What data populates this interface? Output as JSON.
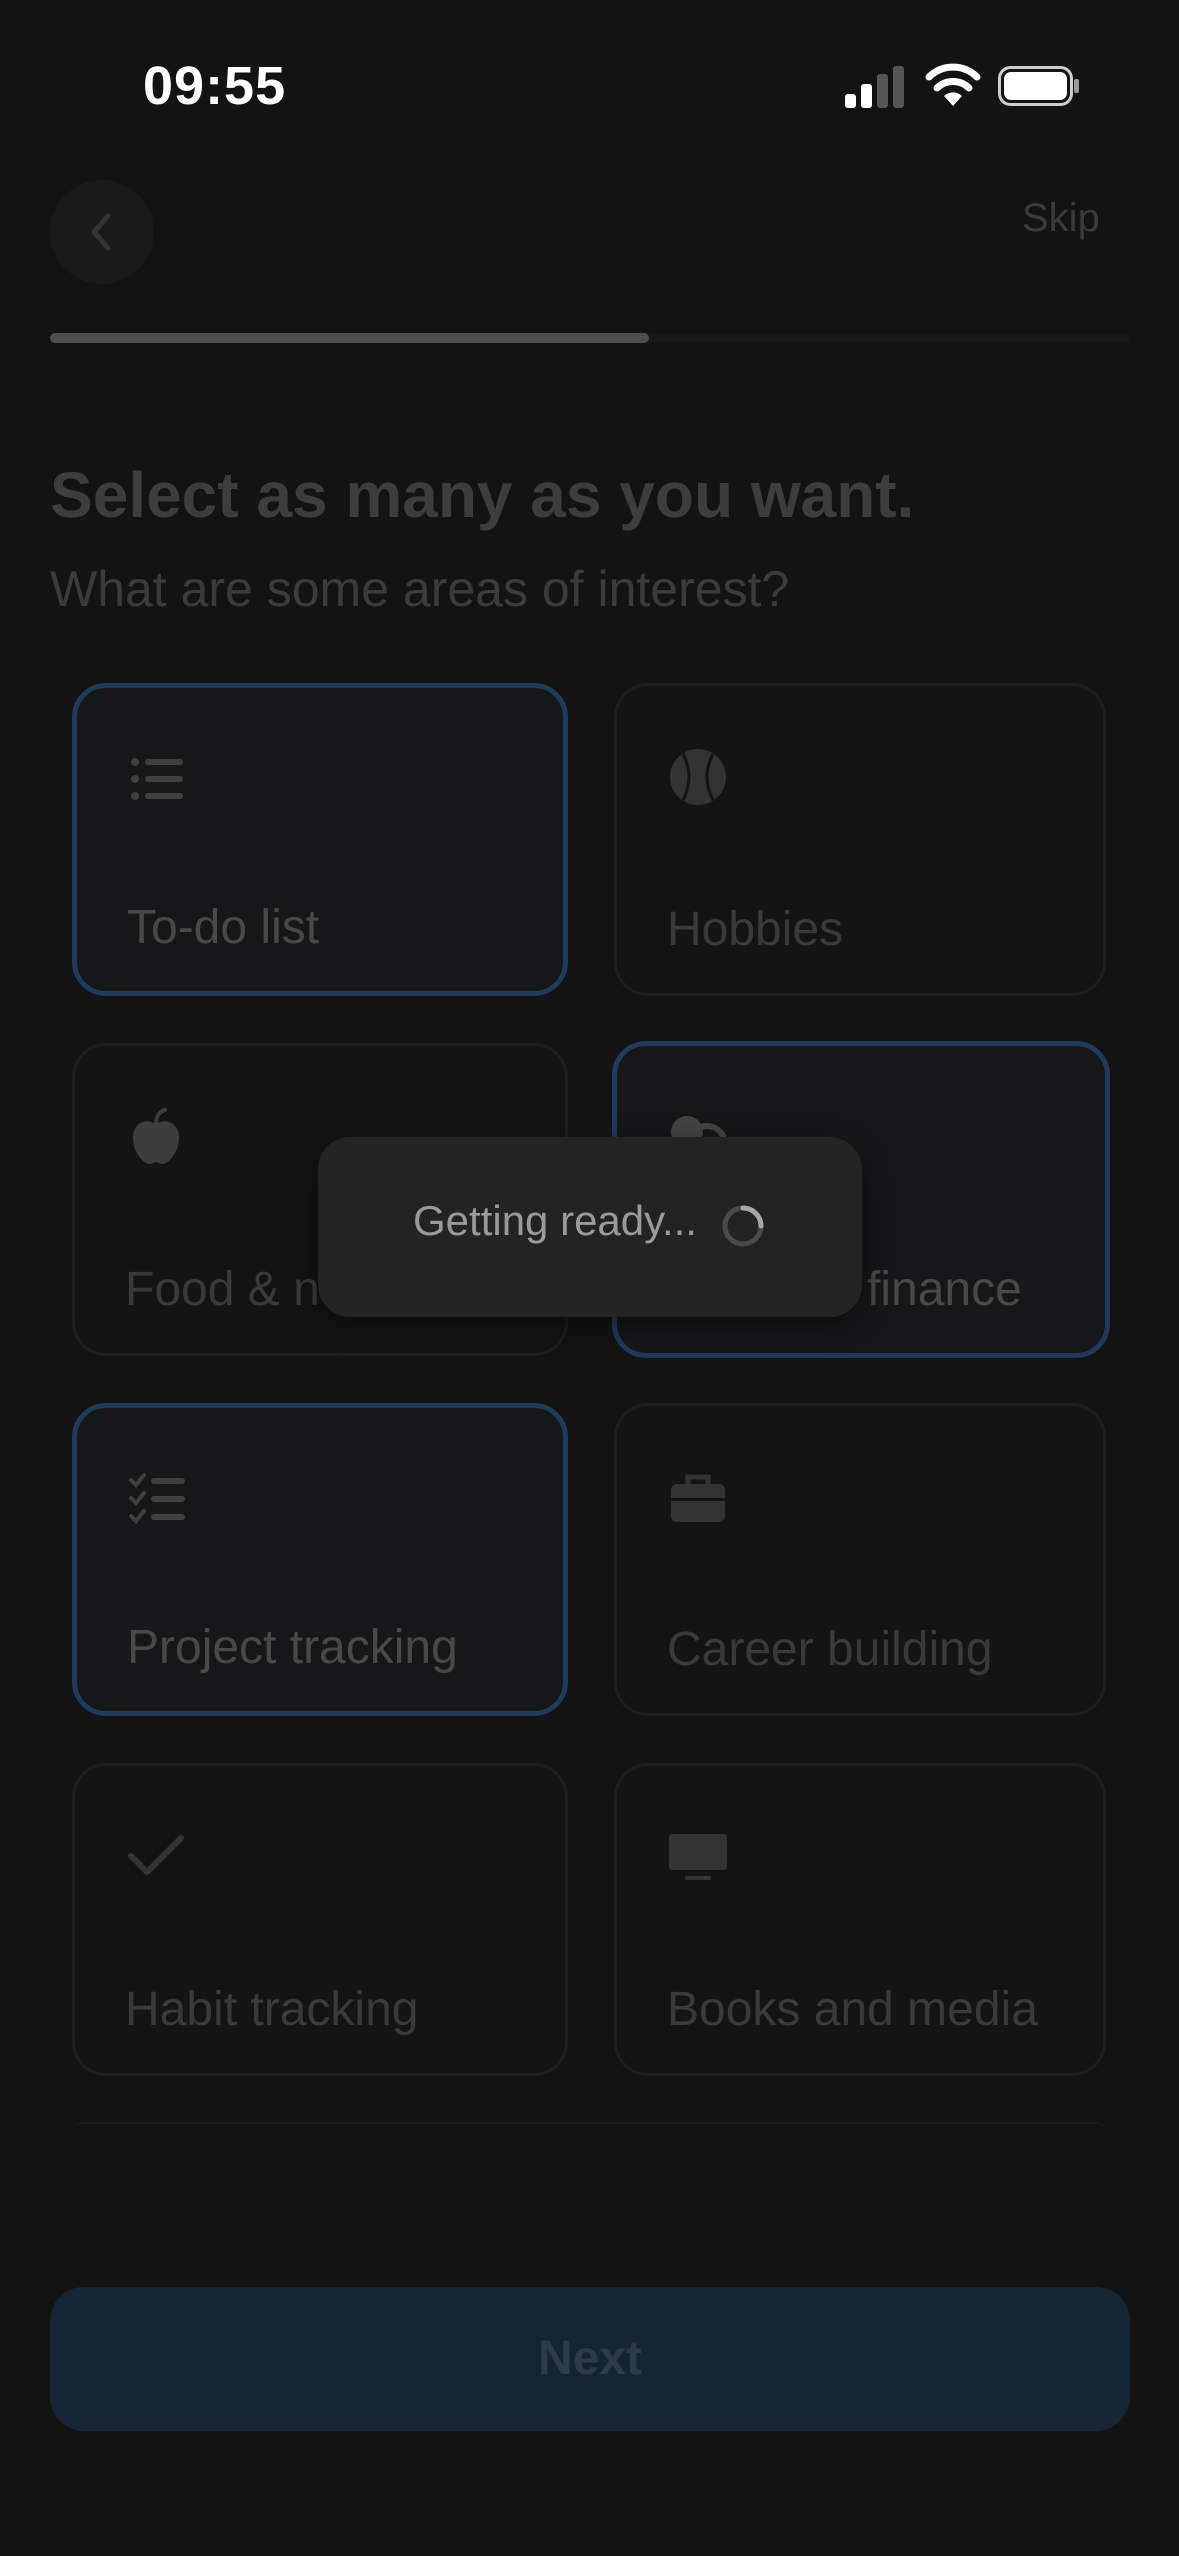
{
  "status": {
    "time": "09:55"
  },
  "header": {
    "skip_label": "Skip",
    "progress": 0.555
  },
  "title": "Select as many as you want.",
  "subtitle": "What are some areas of interest?",
  "cards": [
    {
      "label": "To-do list",
      "icon": "list-icon",
      "selected": true
    },
    {
      "label": "Hobbies",
      "icon": "baseball-icon",
      "selected": false
    },
    {
      "label": "Food & n",
      "icon": "apple-icon",
      "selected": false
    },
    {
      "label": "finance",
      "icon": "coins-icon",
      "selected": true
    },
    {
      "label": "Project tracking",
      "icon": "checklist-icon",
      "selected": true
    },
    {
      "label": "Career building",
      "icon": "briefcase-icon",
      "selected": false
    },
    {
      "label": "Habit tracking",
      "icon": "checkmark-icon",
      "selected": false
    },
    {
      "label": "Books and media",
      "icon": "monitor-icon",
      "selected": false
    }
  ],
  "next_label": "Next",
  "toast": {
    "text": "Getting ready..."
  },
  "colors": {
    "accent_border": "#1f3a5c",
    "next_bg": "#162536",
    "background": "#131313"
  }
}
